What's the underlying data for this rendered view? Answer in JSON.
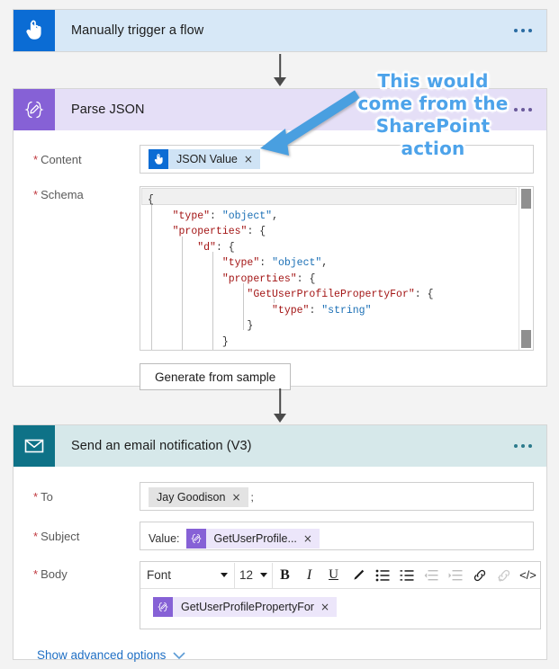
{
  "flow": {
    "trigger": {
      "title": "Manually trigger a flow",
      "icon": "hand-pointer-icon",
      "menu": "more-options-ellipsis"
    },
    "parse_json": {
      "title": "Parse JSON",
      "icon": "json-braces-pencil-icon",
      "menu": "more-options-ellipsis",
      "content": {
        "label": "Content",
        "required_mark": "*",
        "token": {
          "text": "JSON Value",
          "remove": "×",
          "icon": "hand-pointer-icon"
        }
      },
      "schema": {
        "label": "Schema",
        "required_mark": "*",
        "code_lines": [
          "{",
          "    \"type\": \"object\",",
          "    \"properties\": {",
          "        \"d\": {",
          "            \"type\": \"object\",",
          "            \"properties\": {",
          "                \"GetUserProfilePropertyFor\": {",
          "                    \"type\": \"string\"",
          "                }",
          "            }"
        ]
      },
      "generate_button": "Generate from sample"
    },
    "email": {
      "title": "Send an email notification (V3)",
      "icon": "envelope-icon",
      "menu": "more-options-ellipsis",
      "to": {
        "label": "To",
        "required_mark": "*",
        "chip": {
          "text": "Jay Goodison",
          "remove": "×"
        },
        "separator": ";"
      },
      "subject": {
        "label": "Subject",
        "required_mark": "*",
        "value_prefix": "Value:",
        "chip": {
          "text": "GetUserProfile...",
          "remove": "×",
          "icon": "json-braces-pencil-icon"
        }
      },
      "body": {
        "label": "Body",
        "required_mark": "*",
        "toolbar": {
          "font_select": "Font",
          "size_select": "12",
          "buttons": [
            {
              "name": "bold-icon",
              "glyph": "B",
              "disabled": false
            },
            {
              "name": "italic-icon",
              "glyph": "I",
              "disabled": false
            },
            {
              "name": "underline-icon",
              "glyph": "U",
              "disabled": false
            },
            {
              "name": "text-color-pen-icon",
              "glyph": "✎",
              "disabled": false
            },
            {
              "name": "bulleted-list-icon",
              "glyph": "☰",
              "disabled": false
            },
            {
              "name": "numbered-list-icon",
              "glyph": "☰",
              "disabled": false
            },
            {
              "name": "decrease-indent-icon",
              "glyph": "⇤",
              "disabled": true
            },
            {
              "name": "increase-indent-icon",
              "glyph": "⇥",
              "disabled": true
            },
            {
              "name": "insert-link-icon",
              "glyph": "🔗",
              "disabled": false
            },
            {
              "name": "remove-link-icon",
              "glyph": "🔗",
              "disabled": true
            },
            {
              "name": "code-view-icon",
              "glyph": "</>",
              "disabled": false
            }
          ]
        },
        "chip": {
          "text": "GetUserProfilePropertyFor",
          "remove": "×",
          "icon": "json-braces-pencil-icon"
        }
      },
      "advanced_link": "Show advanced options"
    }
  },
  "annotation": {
    "lines": [
      "This would",
      "come from the",
      "SharePoint",
      "action"
    ],
    "color": "#4da3ea",
    "arrow": "pointer-arrow-to-content-token"
  },
  "colors": {
    "trigger_header": "#d7e8f7",
    "trigger_icon": "#0b6cd4",
    "parse_header": "#e5dff7",
    "parse_icon": "#8661d6",
    "email_header": "#d6e8ea",
    "email_icon": "#0e7287",
    "required_asterisk": "#c0393f",
    "link": "#1f6fc4",
    "canvas": "#f3f3f3"
  }
}
